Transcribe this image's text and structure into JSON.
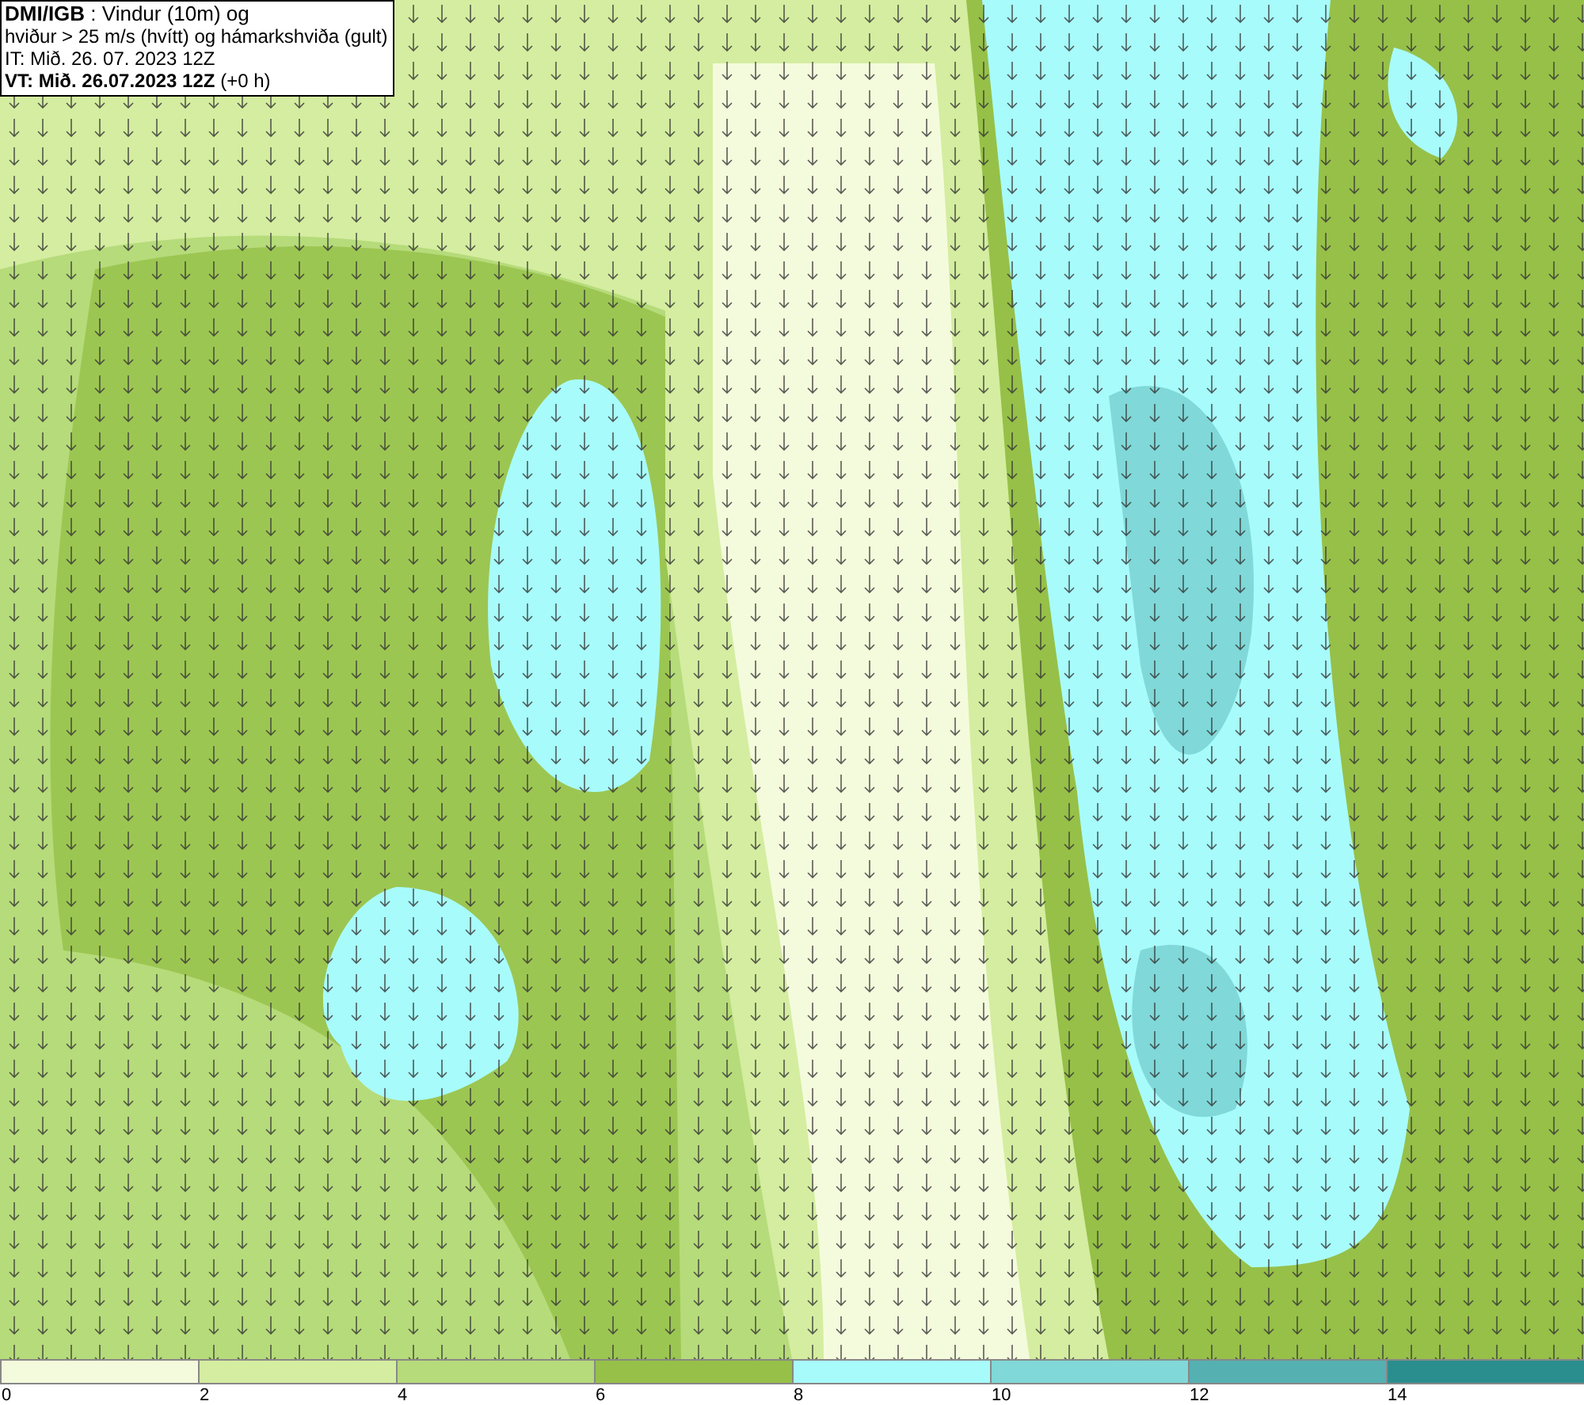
{
  "title_box": {
    "lines": [
      "**DMI/IGB** : Vindur (10m) og",
      "hviður > 25 m/s (hvítt) og hámarkshviða (gult)",
      "IT: Mið. 26. 07. 2023 12Z",
      "**VT: Mið. 26.07.2023 12Z** (+0 h)"
    ]
  },
  "legend": [
    {
      "label": "0",
      "color": "#f4fbdc"
    },
    {
      "label": "2",
      "color": "#d4eda0"
    },
    {
      "label": "4",
      "color": "#b6db7a"
    },
    {
      "label": "6",
      "color": "#96c048"
    },
    {
      "label": "8",
      "color": "#a8fbfb"
    },
    {
      "label": "10",
      "color": "#80d8d8"
    },
    {
      "label": "12",
      "color": "#55b0b2"
    },
    {
      "label": "14",
      "color": "#2a8e8e"
    }
  ]
}
